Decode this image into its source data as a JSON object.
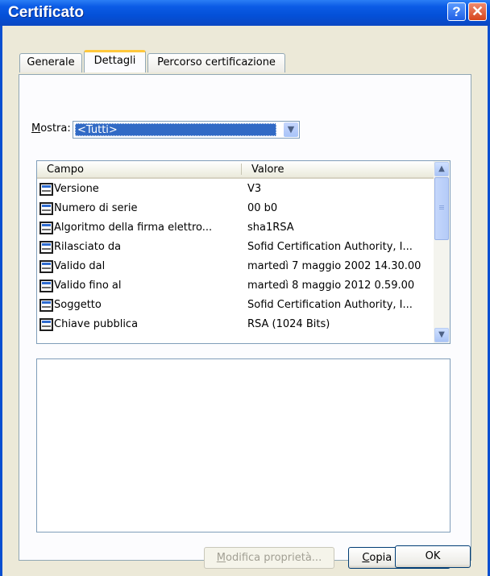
{
  "window": {
    "title": "Certificato"
  },
  "titlebar": {
    "help_glyph": "?",
    "close_glyph": "✕"
  },
  "tabs": [
    {
      "label": "Generale"
    },
    {
      "label": "Dettagli"
    },
    {
      "label": "Percorso certificazione"
    }
  ],
  "show": {
    "label_underlined": "M",
    "label_rest": "ostra:",
    "value": "<Tutti>"
  },
  "list": {
    "columns": [
      "Campo",
      "Valore"
    ],
    "rows": [
      {
        "field": "Versione",
        "value": "V3"
      },
      {
        "field": "Numero di serie",
        "value": "00 b0"
      },
      {
        "field": "Algoritmo della firma elettro...",
        "value": "sha1RSA"
      },
      {
        "field": "Rilasciato da",
        "value": "Sofid Certification Authority, I..."
      },
      {
        "field": "Valido dal",
        "value": "martedì 7 maggio 2002 14.30.00"
      },
      {
        "field": "Valido fino al",
        "value": "martedì 8 maggio 2012 0.59.00"
      },
      {
        "field": "Soggetto",
        "value": "Sofid Certification Authority, I..."
      },
      {
        "field": "Chiave pubblica",
        "value": "RSA (1024 Bits)"
      }
    ]
  },
  "buttons": {
    "edit_underlined": "M",
    "edit_rest": "odifica proprietà...",
    "copy_underlined": "C",
    "copy_rest": "opia su file...",
    "ok": "OK"
  },
  "colors": {
    "titlebar": "#0450d8",
    "selection": "#316ac5",
    "active_tab_accent": "#ffc83c",
    "dialog_bg": "#ece9d8"
  }
}
